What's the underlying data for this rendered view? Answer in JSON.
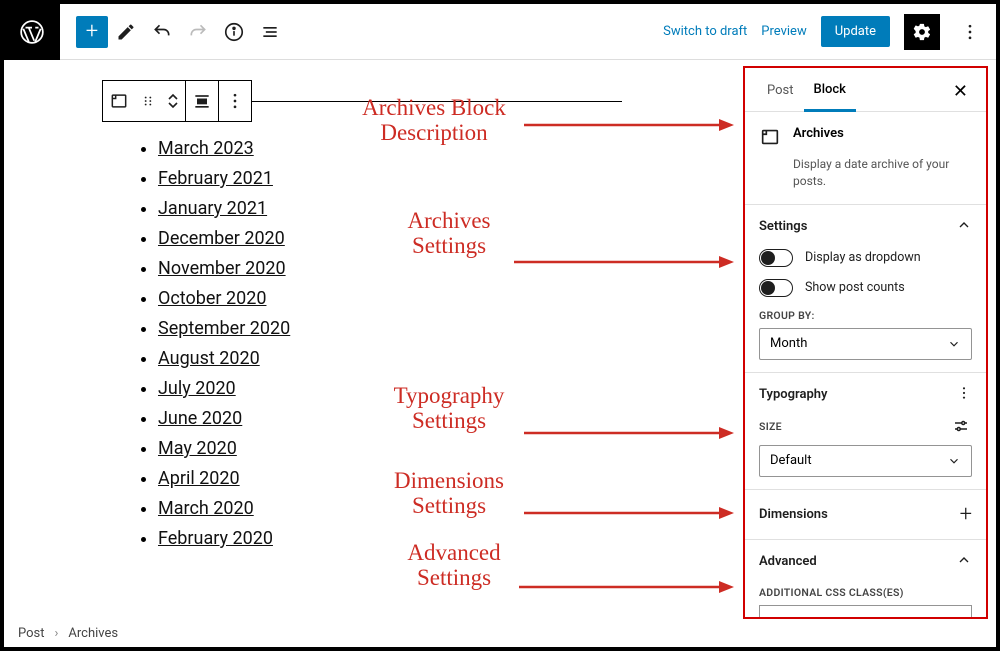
{
  "topbar": {
    "switch_draft": "Switch to draft",
    "preview": "Preview",
    "update": "Update"
  },
  "archive_items": [
    "March 2023",
    "February 2021",
    "January 2021",
    "December 2020",
    "November 2020",
    "October 2020",
    "September 2020",
    "August 2020",
    "July 2020",
    "June 2020",
    "May 2020",
    "April 2020",
    "March 2020",
    "February 2020"
  ],
  "annotations": {
    "desc1": "Archives Block",
    "desc2": "Description",
    "set1": "Archives",
    "set2": "Settings",
    "typo1": "Typography",
    "typo2": "Settings",
    "dim1": "Dimensions",
    "dim2": "Settings",
    "adv1": "Advanced",
    "adv2": "Settings"
  },
  "sidebar": {
    "tab_post": "Post",
    "tab_block": "Block",
    "block_name": "Archives",
    "block_desc": "Display a date archive of your posts.",
    "settings_title": "Settings",
    "toggle_dropdown": "Display as dropdown",
    "toggle_counts": "Show post counts",
    "group_by_label": "Group by:",
    "group_by_value": "Month",
    "typography_title": "Typography",
    "size_label": "Size",
    "size_value": "Default",
    "dimensions_title": "Dimensions",
    "advanced_title": "Advanced",
    "css_label": "Additional CSS class(es)"
  },
  "breadcrumb": {
    "root": "Post",
    "leaf": "Archives"
  }
}
